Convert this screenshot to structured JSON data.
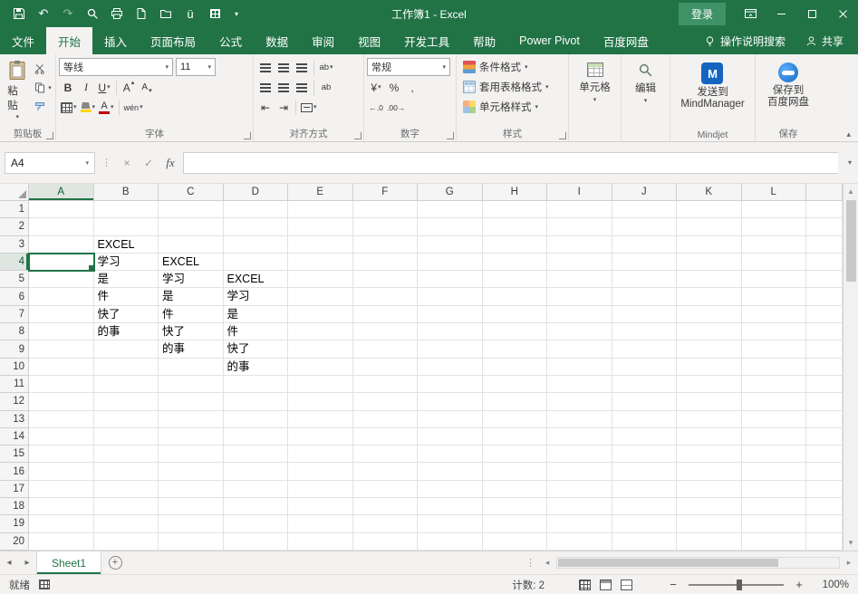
{
  "titlebar": {
    "title": "工作簿1 - Excel",
    "login": "登录"
  },
  "tabs": {
    "file": "文件",
    "items": [
      "开始",
      "插入",
      "页面布局",
      "公式",
      "数据",
      "审阅",
      "视图",
      "开发工具",
      "帮助",
      "Power Pivot",
      "百度网盘"
    ],
    "tell_me": "操作说明搜索",
    "share": "共享"
  },
  "ribbon": {
    "clipboard": {
      "label": "剪贴板",
      "paste": "粘贴"
    },
    "font": {
      "label": "字体",
      "name": "等线",
      "size": "11",
      "bold": "B",
      "italic": "I",
      "underline": "U",
      "grow": "A",
      "shrink": "A",
      "color_a": "A",
      "pinyin": "wén"
    },
    "alignment": {
      "label": "对齐方式",
      "wrap": "ab",
      "orient": "ab"
    },
    "number": {
      "label": "数字",
      "format": "常规",
      "currency": "¥",
      "percent": "%",
      "comma": ",",
      "inc_decimal": "←.0",
      "dec_decimal": ".00→"
    },
    "styles": {
      "label": "样式",
      "conditional": "条件格式",
      "format_table": "套用表格格式",
      "cell_styles": "单元格样式"
    },
    "cells": {
      "label": "单元格"
    },
    "editing": {
      "label": "编辑"
    },
    "mindjet": {
      "group": "Mindjet",
      "line1": "发送到",
      "line2": "MindManager",
      "logo": "M"
    },
    "netdisk": {
      "group": "保存",
      "line1": "保存到",
      "line2": "百度网盘"
    }
  },
  "formula": {
    "name_box": "A4",
    "fx": "fx"
  },
  "grid": {
    "columns": [
      "A",
      "B",
      "C",
      "D",
      "E",
      "F",
      "G",
      "H",
      "I",
      "J",
      "K",
      "L"
    ],
    "row_count": 20,
    "selected_cell": "A4",
    "selected_col": "A",
    "selected_row": 4,
    "cells": {
      "B3": "EXCEL",
      "B4": "学习",
      "B5": "是",
      "B6": "件",
      "B7": "快了",
      "B8": "的事",
      "C4": "EXCEL",
      "C5": "学习",
      "C6": "是",
      "C7": "件",
      "C8": "快了",
      "C9": "的事",
      "D5": "EXCEL",
      "D6": "学习",
      "D7": "是",
      "D8": "件",
      "D9": "快了",
      "D10": "的事"
    }
  },
  "sheets": {
    "active": "Sheet1"
  },
  "status": {
    "ready": "就绪",
    "count": "计数: 2",
    "zoom": "100%",
    "zoom_out": "−",
    "zoom_in": "+"
  },
  "icons": {
    "undo": "↶",
    "redo": "↷",
    "dropdown": "▾",
    "collapse": "▴",
    "cancel": "×",
    "enter": "✓",
    "up": "▴",
    "down": "▾",
    "left": "◂",
    "right": "▸",
    "outdent": "⇤",
    "indent": "⇥",
    "new_sheet": "+",
    "ellipsis": "⋮",
    "phonetic": "ü"
  }
}
